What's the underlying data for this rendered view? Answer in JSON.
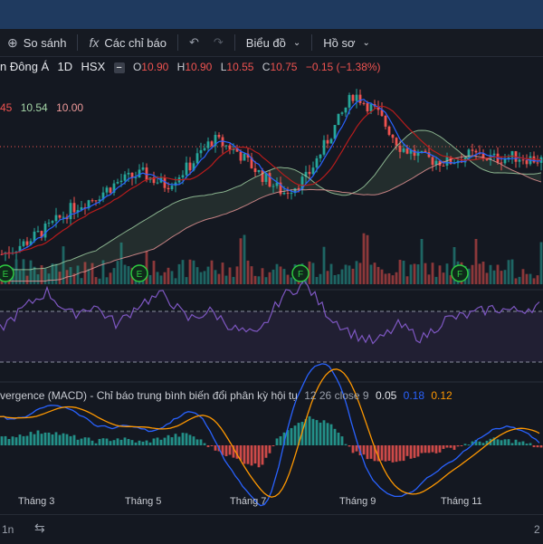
{
  "toolbar": {
    "compare_label": "So sánh",
    "indicators_label": "Các chỉ báo",
    "chart_type_label": "Biểu đồ",
    "profile_label": "Hồ sơ"
  },
  "legend": {
    "symbol": "n Đông Á",
    "interval": "1D",
    "exchange": "HSX",
    "o_label": "O",
    "o_value": "10.90",
    "h_label": "H",
    "h_value": "10.90",
    "l_label": "L",
    "l_value": "10.55",
    "c_label": "C",
    "c_value": "10.75",
    "change": "−0.15 (−1.38%)"
  },
  "ichimoku_values": [
    "45",
    "10.54",
    "10.00"
  ],
  "macd_legend": {
    "title": "vergence (MACD) - Chỉ báo trung bình biến đổi phân kỳ hội tụ",
    "params": "12 26 close 9",
    "v1": "0.05",
    "v2": "0.18",
    "v3": "0.12"
  },
  "x_axis": [
    "Tháng 3",
    "Tháng 5",
    "Tháng 7",
    "Tháng 9",
    "Tháng 11"
  ],
  "bottom": {
    "left_text": "1n",
    "right_text": "2"
  },
  "colors": {
    "up": "#26a69a",
    "down": "#ef5350",
    "rsi": "#7e57c2",
    "macd": "#2962ff",
    "signal": "#ff9800",
    "cloud_up": "#a5d6a7",
    "cloud_down": "#ef9a9a"
  },
  "markers": [
    "E",
    "E",
    "F",
    "F"
  ],
  "chart_data": {
    "type": "line",
    "price_close_approx": [
      8.3,
      8.6,
      9.0,
      9.5,
      9.8,
      10.2,
      10.4,
      10.1,
      10.6,
      11.3,
      11.0,
      10.4,
      9.9,
      10.3,
      11.4,
      12.5,
      12.0,
      11.1,
      10.8,
      10.7,
      10.9,
      10.8,
      10.85,
      10.75
    ],
    "price_x_labels": [
      "Tháng 3",
      "Tháng 5",
      "Tháng 7",
      "Tháng 9",
      "Tháng 11"
    ],
    "rsi_approx": [
      45,
      60,
      72,
      55,
      62,
      48,
      64,
      70,
      52,
      58,
      45,
      40,
      68,
      78,
      55,
      42,
      35,
      48,
      38,
      52,
      55,
      60,
      58,
      62
    ],
    "macd_histogram_approx": [
      0.05,
      0.08,
      0.1,
      0.06,
      0.03,
      0.05,
      0.02,
      0.06,
      0.08,
      -0.02,
      -0.1,
      -0.15,
      0.1,
      0.2,
      0.15,
      -0.05,
      -0.12,
      -0.1,
      -0.06,
      -0.03,
      0.02,
      0.04,
      0.03,
      -0.02
    ]
  }
}
